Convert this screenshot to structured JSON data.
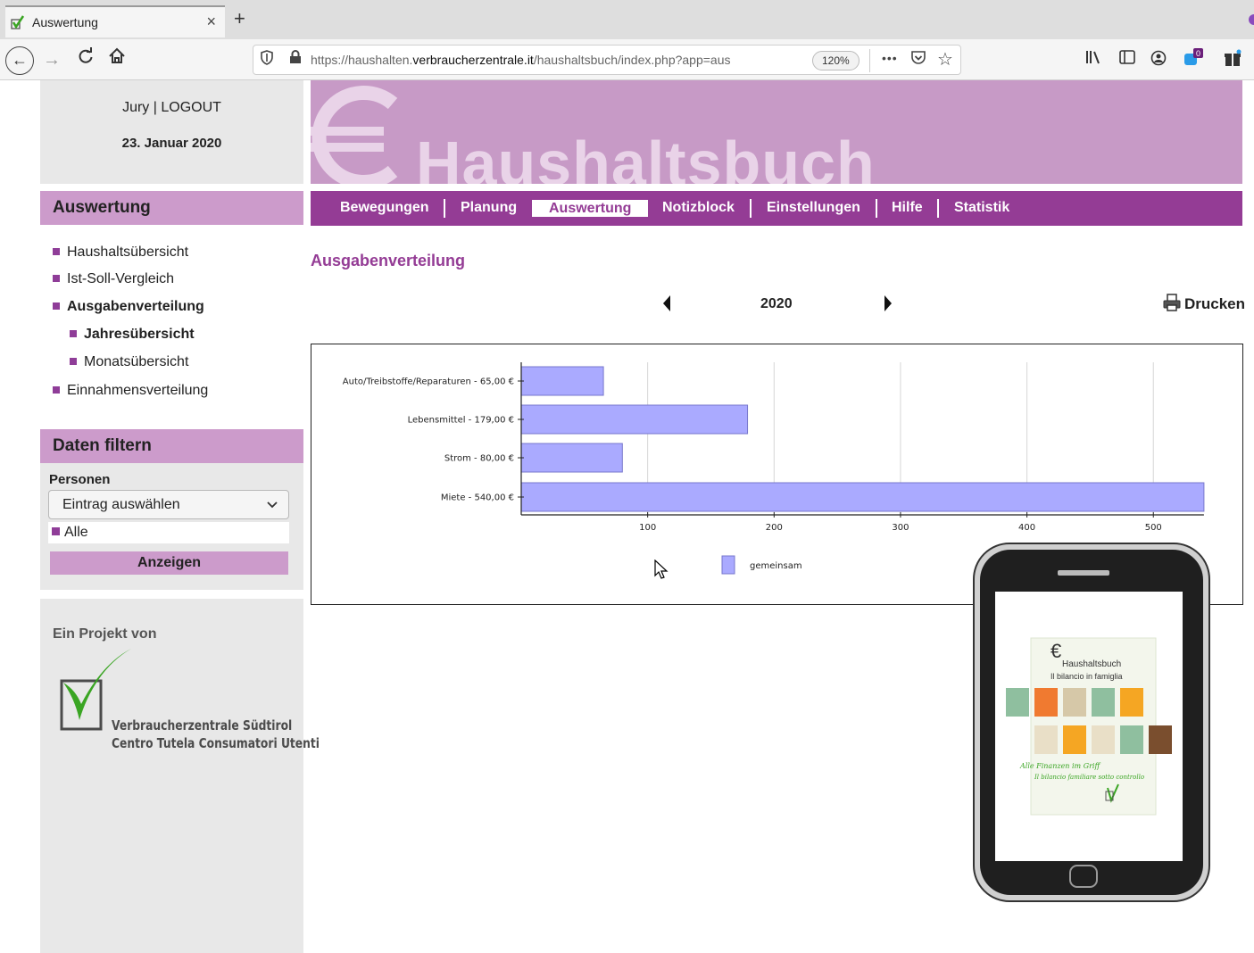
{
  "browser": {
    "tab_title": "Auswertung",
    "tab_close": "×",
    "new_tab": "+",
    "url_prefix": "https://haushalten.",
    "url_domain": "verbraucherzentrale.it",
    "url_path": "/haushaltsbuch/index.php?app=aus",
    "zoom": "120%",
    "more": "•••",
    "extension_badge": "0"
  },
  "sidebar": {
    "user_line": "Jury | LOGOUT",
    "date": "23. Januar 2020",
    "nav_heading": "Auswertung",
    "nav_items": [
      {
        "label": "Haushaltsübersicht"
      },
      {
        "label": "Ist-Soll-Vergleich"
      },
      {
        "label": "Ausgabenverteilung"
      },
      {
        "label": "Jahresübersicht"
      },
      {
        "label": "Monatsübersicht"
      },
      {
        "label": "Einnahmensverteilung"
      }
    ],
    "filter_heading": "Daten filtern",
    "persons_label": "Personen",
    "person_select_value": "Eintrag auswählen",
    "alle": "Alle",
    "show_button": "Anzeigen",
    "project_label": "Ein Projekt von",
    "logo_line1": "Verbraucherzentrale Südtirol",
    "logo_line2": "Centro Tutela Consumatori Utenti"
  },
  "banner": {
    "title": "Haushaltsbuch"
  },
  "menu": {
    "items": [
      {
        "label": "Bewegungen"
      },
      {
        "label": "Planung"
      },
      {
        "label": "Auswertung"
      },
      {
        "label": "Notizblock"
      },
      {
        "label": "Einstellungen"
      },
      {
        "label": "Hilfe"
      },
      {
        "label": "Statistik"
      }
    ],
    "active": "Auswertung"
  },
  "main": {
    "section_title": "Ausgabenverteilung",
    "year": "2020",
    "print_label": "Drucken"
  },
  "chart_data": {
    "type": "bar",
    "orientation": "horizontal",
    "categories": [
      "Auto/Treibstoffe/Reparaturen - 65,00 €",
      "Lebensmittel - 179,00 €",
      "Strom - 80,00 €",
      "Miete - 540,00 €"
    ],
    "series": [
      {
        "name": "gemeinsam",
        "values": [
          65,
          179,
          80,
          540
        ]
      }
    ],
    "x_ticks": [
      100,
      200,
      300,
      400,
      500
    ],
    "xlim": [
      0,
      540
    ],
    "grid": true,
    "legend_position": "bottom",
    "colors": {
      "bar": "#aaaaff",
      "bar_edge": "#7777cc",
      "grid": "#d6d6d6"
    }
  },
  "phone_ad": {
    "brand": "Haushaltsbuch",
    "subtitle": "Il bilancio in famiglia",
    "slogan1": "Alle Finanzen im Griff",
    "slogan2": "Il bilancio familiare sotto controllo"
  },
  "colors": {
    "brand_purple": "#943c95",
    "light_purple": "#cc9bcb",
    "banner_purple": "#c79ac6",
    "sidebar_gray": "#e8e8e8",
    "logo_green": "#3aa523"
  }
}
